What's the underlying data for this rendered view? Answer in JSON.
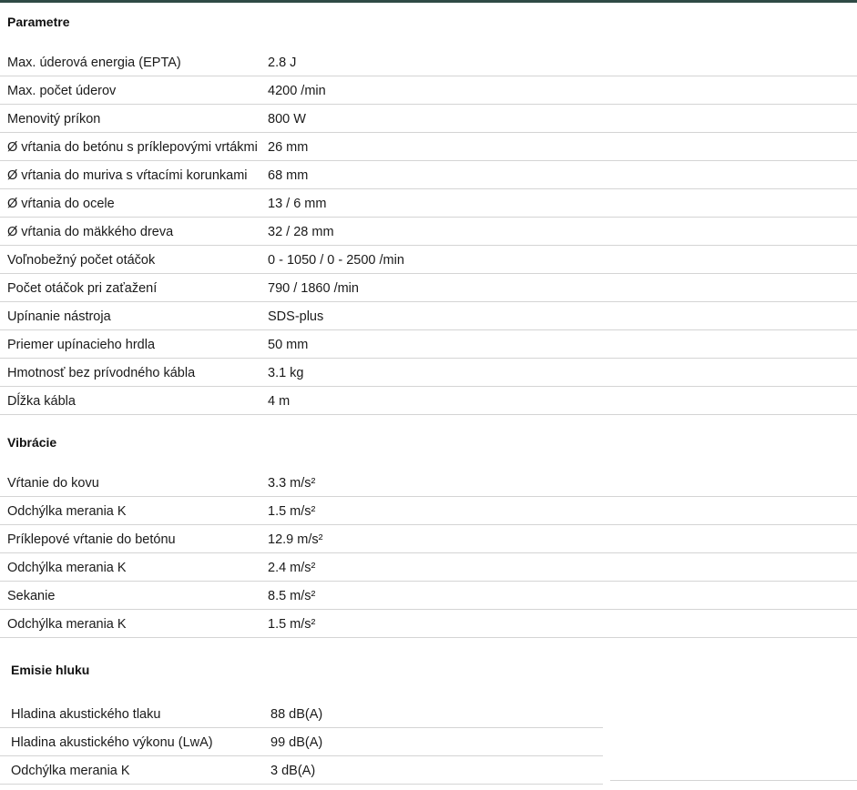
{
  "parametre": {
    "title": "Parametre",
    "rows": [
      {
        "label": "Max. úderová energia (EPTA)",
        "value": "2.8 J"
      },
      {
        "label": "Max. počet úderov",
        "value": "4200 /min"
      },
      {
        "label": "Menovitý príkon",
        "value": "800 W"
      },
      {
        "label": "Ø vŕtania do betónu s príklepovými vrtákmi",
        "value": "26 mm"
      },
      {
        "label": "Ø vŕtania do muriva s vŕtacími korunkami",
        "value": "68 mm"
      },
      {
        "label": "Ø vŕtania do ocele",
        "value": "13 / 6 mm"
      },
      {
        "label": "Ø vŕtania do mäkkého dreva",
        "value": "32 / 28 mm"
      },
      {
        "label": "Voľnobežný počet otáčok",
        "value": "0 - 1050 / 0 - 2500 /min"
      },
      {
        "label": "Počet otáčok pri zaťažení",
        "value": "790 / 1860 /min"
      },
      {
        "label": "Upínanie nástroja",
        "value": "SDS-plus"
      },
      {
        "label": "Priemer upínacieho hrdla",
        "value": "50 mm"
      },
      {
        "label": "Hmotnosť bez prívodného kábla",
        "value": "3.1 kg"
      },
      {
        "label": "Dĺžka kábla",
        "value": "4 m"
      }
    ]
  },
  "vibracie": {
    "title": "Vibrácie",
    "rows": [
      {
        "label": "Vŕtanie do kovu",
        "value": "3.3 m/s²"
      },
      {
        "label": "Odchýlka merania K",
        "value": "1.5 m/s²"
      },
      {
        "label": "Príklepové vŕtanie do betónu",
        "value": "12.9 m/s²"
      },
      {
        "label": "Odchýlka merania K",
        "value": "2.4 m/s²"
      },
      {
        "label": "Sekanie",
        "value": "8.5 m/s²"
      },
      {
        "label": "Odchýlka merania K",
        "value": "1.5 m/s²"
      }
    ]
  },
  "emisie": {
    "title": "Emisie hluku",
    "rows": [
      {
        "label": "Hladina akustického tlaku",
        "value": "88 dB(A)"
      },
      {
        "label": "Hladina akustického výkonu (LwA)",
        "value": "99 dB(A)"
      },
      {
        "label": "Odchýlka merania K",
        "value": "3 dB(A)"
      }
    ]
  },
  "colors": {
    "topbar": "#2f4a45",
    "divider": "#d4d4d4"
  }
}
